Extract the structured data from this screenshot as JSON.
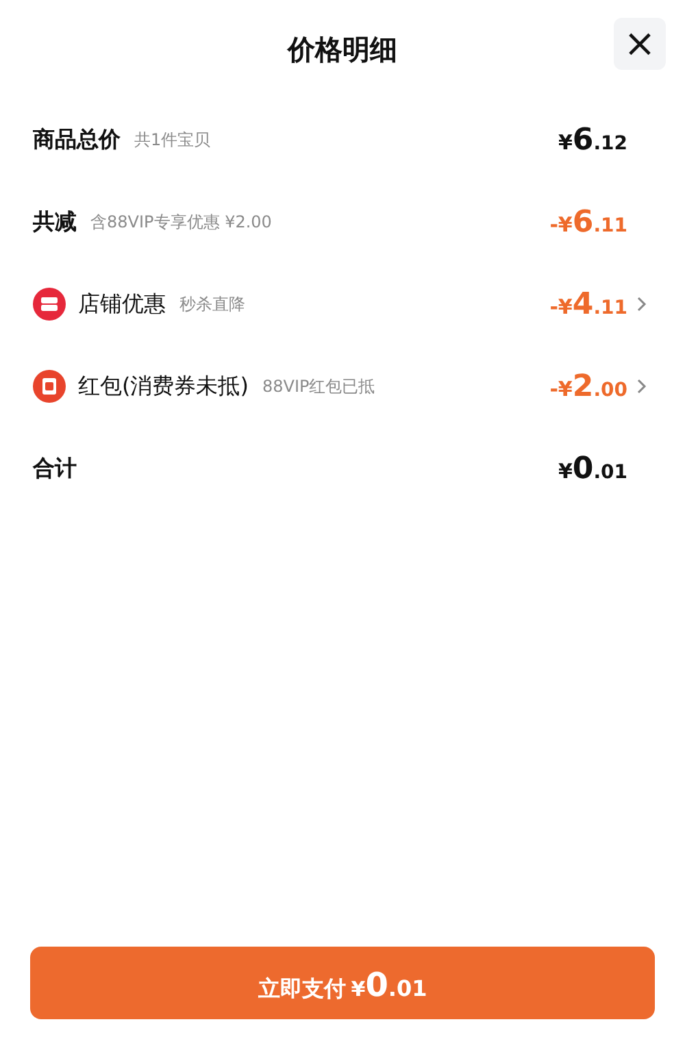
{
  "title": "价格明细",
  "close": "×",
  "rows": [
    {
      "kind": "plain",
      "label": "商品总价",
      "note": "共1件宝贝",
      "amount": "¥6.12",
      "discount": false,
      "expandable": false
    },
    {
      "kind": "plain",
      "label": "共减",
      "note": "含88VIP专享优惠 ¥2.00",
      "amount": "-¥6.11",
      "discount": true,
      "expandable": false
    },
    {
      "kind": "shop",
      "label": "店铺优惠",
      "note": "秒杀直降",
      "amount": "-¥4.11",
      "discount": true,
      "expandable": true
    },
    {
      "kind": "red-packet",
      "label": "红包(消费券未抵)",
      "note": "88VIP红包已抵",
      "amount": "-¥2.00",
      "discount": true,
      "expandable": true
    },
    {
      "kind": "plain",
      "label": "合计",
      "amount": "¥0.01",
      "discount": false,
      "expandable": false
    }
  ],
  "pay_button": {
    "label": "立即支付",
    "amount": "¥0.01"
  }
}
